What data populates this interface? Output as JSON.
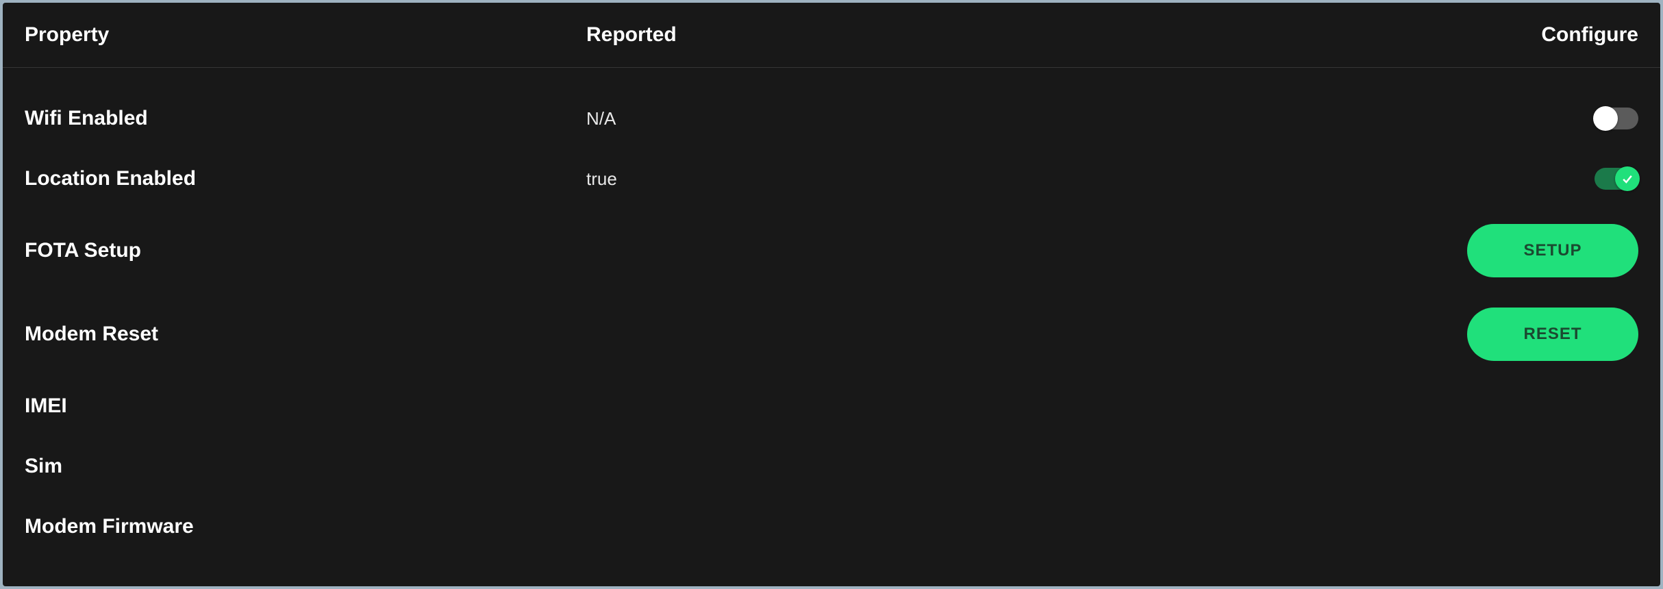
{
  "header": {
    "property": "Property",
    "reported": "Reported",
    "configure": "Configure"
  },
  "rows": {
    "wifi": {
      "label": "Wifi Enabled",
      "reported": "N/A"
    },
    "location": {
      "label": "Location Enabled",
      "reported": "true"
    },
    "fota": {
      "label": "FOTA Setup",
      "button": "SETUP"
    },
    "modemReset": {
      "label": "Modem Reset",
      "button": "RESET"
    },
    "imei": {
      "label": "IMEI"
    },
    "sim": {
      "label": "Sim"
    },
    "modemFw": {
      "label": "Modem Firmware"
    }
  },
  "colors": {
    "accent": "#20e07b",
    "panel": "#181818"
  }
}
